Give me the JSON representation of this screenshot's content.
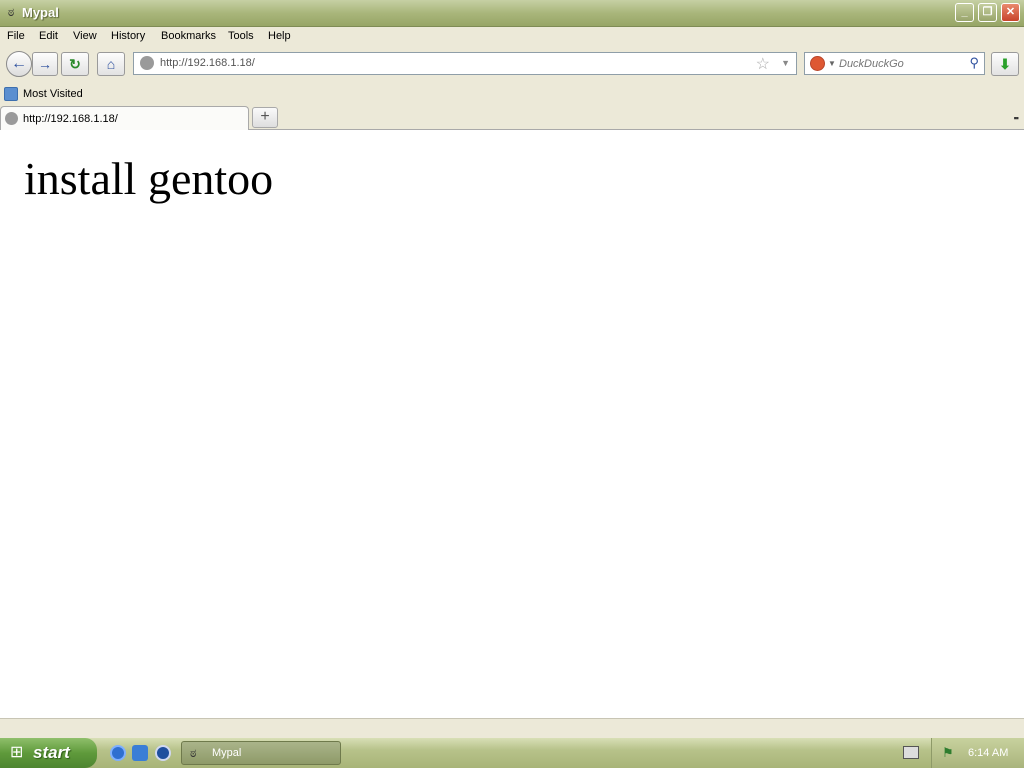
{
  "window": {
    "title": "Mypal",
    "icon": "raccoon-icon",
    "controls": [
      "minimize",
      "restore",
      "close"
    ]
  },
  "menu": [
    "File",
    "Edit",
    "View",
    "History",
    "Bookmarks",
    "Tools",
    "Help"
  ],
  "nav": {
    "url": "http://192.168.1.18/",
    "search_placeholder": "DuckDuckGo"
  },
  "bookmarks": {
    "most_visited": "Most Visited"
  },
  "tabs": [
    {
      "label": "http://192.168.1.18/"
    }
  ],
  "page": {
    "heading": "install gentoo"
  },
  "taskbar": {
    "start_label": "start",
    "tasks": [
      {
        "label": "Mypal"
      }
    ],
    "clock": "6:14 AM"
  },
  "colors": {
    "titlebar": "#a9b67b",
    "chrome": "#ece9d8",
    "start_button": "#5f9a3b"
  }
}
